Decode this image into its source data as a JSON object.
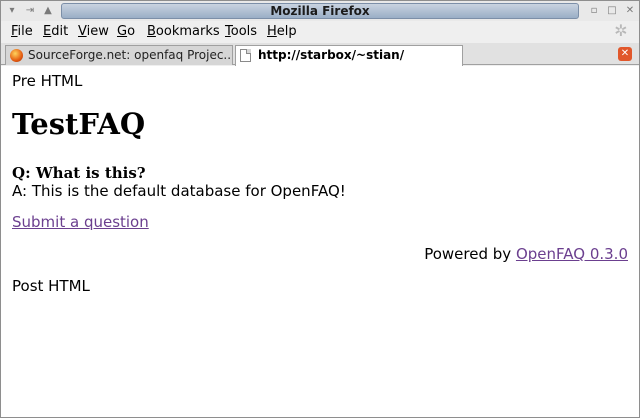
{
  "window": {
    "title": "Mozilla Firefox",
    "controls": {
      "minimize": "▫",
      "maximize": "□"
    }
  },
  "menu": {
    "items": [
      {
        "accel": "F",
        "rest": "ile"
      },
      {
        "accel": "E",
        "rest": "dit"
      },
      {
        "accel": "V",
        "rest": "iew"
      },
      {
        "accel": "G",
        "rest": "o"
      },
      {
        "accel": "B",
        "rest": "ookmarks"
      },
      {
        "accel": "T",
        "rest": "ools"
      },
      {
        "accel": "H",
        "rest": "elp"
      }
    ]
  },
  "tabs": [
    {
      "label": "SourceForge.net: openfaq Projec...",
      "icon": "firefox-icon",
      "active": false
    },
    {
      "label": "http://starbox/~stian/",
      "icon": "page-icon",
      "active": true
    }
  ],
  "page": {
    "pre_html": "Pre HTML",
    "title": "TestFAQ",
    "question": "Q: What is this?",
    "answer": "A: This is the default database for OpenFAQ!",
    "submit_link": "Submit a question",
    "powered_prefix": "Powered by ",
    "powered_link": "OpenFAQ 0.3.0",
    "post_html": "Post HTML"
  },
  "colors": {
    "link": "#6b3f8f",
    "title_bar": "#9aaec6",
    "close_tab": "#e1572b"
  }
}
